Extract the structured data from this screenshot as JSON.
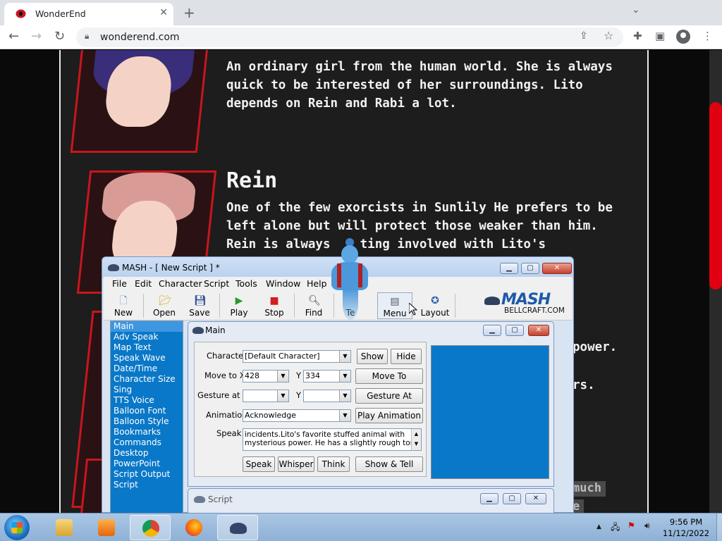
{
  "browser": {
    "tab_title": "WonderEnd",
    "url": "wonderend.com",
    "new_tab": "+",
    "icons": [
      "favicon-icon",
      "close-tab-icon",
      "new-tab-icon",
      "chevron-down-icon",
      "back-icon",
      "forward-icon",
      "reload-icon",
      "lock-icon",
      "share-icon",
      "star-icon",
      "extensions-icon",
      "sidebar-icon",
      "profile-icon",
      "menu-icon"
    ],
    "window_controls": {
      "minimize": "—",
      "restore": "❐",
      "close": "✕"
    }
  },
  "page": {
    "char1_desc": "An ordinary girl from the human world. She is always\nquick to be interested of her surroundings. Lito\ndepends on Rein and Rabi a lot.",
    "char2_name": "Rein",
    "char2_desc": "One of the few exorcists in Sunlily He prefers to be\nleft alone but will protect those weaker than him.\nRein is always    ting involved with Lito's",
    "frag_power": "power.",
    "frag_rs": "rs.",
    "frag_much": "much",
    "frag_e": "e",
    "accent": "#c8161d"
  },
  "mash": {
    "title": "MASH - [ New Script ] *",
    "menu": [
      "File",
      "Edit",
      "Character",
      "Script",
      "Tools",
      "Window",
      "Help"
    ],
    "toolbar": [
      {
        "label": "New",
        "icon": "new-icon"
      },
      {
        "label": "Open",
        "icon": "open-folder-icon"
      },
      {
        "label": "Save",
        "icon": "save-icon"
      },
      {
        "label": "Play",
        "icon": "play-icon"
      },
      {
        "label": "Stop",
        "icon": "stop-icon"
      },
      {
        "label": "Find",
        "icon": "find-icon"
      },
      {
        "label": "Te",
        "icon": "text-icon"
      },
      {
        "label": "Menu",
        "icon": "menu-icon"
      },
      {
        "label": "Layout",
        "icon": "layout-icon"
      }
    ],
    "logo_text": "MASH",
    "logo_sub": "BELLCRAFT.COM",
    "commands": [
      "Main",
      "Adv Speak",
      "Map Text",
      "Speak Wave",
      "Date/Time",
      "Character Size",
      "Sing",
      "TTS Voice",
      "Balloon Font",
      "Balloon Style",
      "Bookmarks",
      "Commands",
      "Desktop",
      "PowerPoint",
      "Script Output",
      "Script"
    ],
    "selected_command": "Main",
    "main_panel": {
      "title": "Main",
      "character_label": "Character",
      "character_value": "[Default Character]",
      "move_label": "Move to X",
      "move_x": "428",
      "move_y_label": "Y",
      "move_y": "334",
      "gesture_label": "Gesture at X",
      "gesture_x": "",
      "gesture_y_label": "Y",
      "gesture_y": "",
      "animation_label": "Animation",
      "animation_value": "Acknowledge",
      "speak_label": "Speak",
      "speak_text": "incidents.Lito's favorite stuffed animal with mysterious power. He has a slightly rough tone",
      "buttons": {
        "show": "Show",
        "hide": "Hide",
        "move_to": "Move To",
        "gesture_at": "Gesture At",
        "play_animation": "Play Animation",
        "speak": "Speak",
        "whisper": "Whisper",
        "think": "Think",
        "show_tell": "Show & Tell"
      },
      "preview_color": "#0a78c8"
    },
    "script_panel": {
      "title": "Script"
    }
  },
  "taskbar": {
    "apps": [
      {
        "name": "explorer-icon",
        "active": false
      },
      {
        "name": "media-player-icon",
        "active": false
      },
      {
        "name": "chrome-icon",
        "active": true
      },
      {
        "name": "firefox-icon",
        "active": false
      },
      {
        "name": "mash-icon",
        "active": true
      }
    ],
    "time": "9:56 PM",
    "date": "11/12/2022",
    "tray_arrow": "▲"
  }
}
